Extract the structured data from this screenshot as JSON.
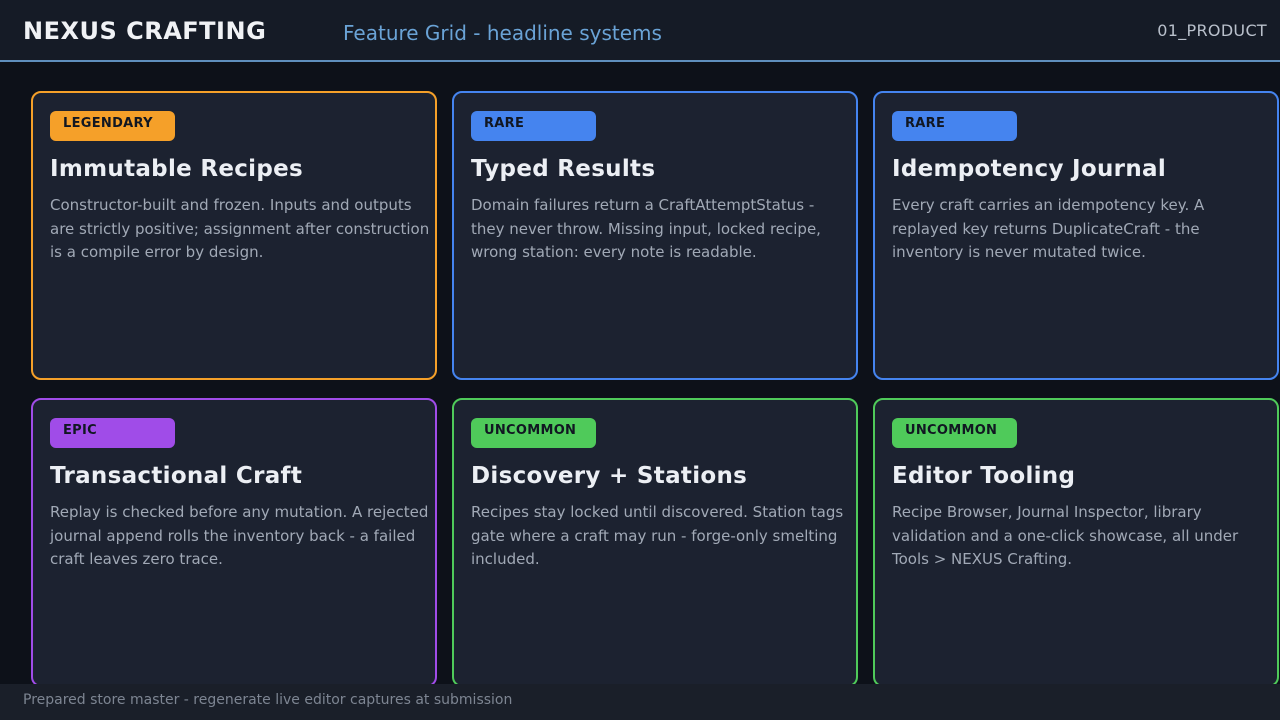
{
  "header": {
    "brand": "NEXUS CRAFTING",
    "subtitle": "Feature Grid - headline systems",
    "page_id": "01_PRODUCT"
  },
  "rarity_colors": {
    "legendary": "#f5a029",
    "rare": "#4584ef",
    "epic": "#a04ce8",
    "uncommon": "#4fca5a"
  },
  "cards": [
    {
      "rarity": "legendary",
      "badge": "LEGENDARY",
      "title": "Immutable Recipes",
      "description": "Constructor-built and frozen. Inputs and outputs are strictly positive; assignment after construction is a compile error by design."
    },
    {
      "rarity": "rare",
      "badge": "RARE",
      "title": "Typed Results",
      "description": "Domain failures return a CraftAttemptStatus - they never throw. Missing input, locked recipe, wrong station: every note is readable."
    },
    {
      "rarity": "rare",
      "badge": "RARE",
      "title": "Idempotency Journal",
      "description": "Every craft carries an idempotency key. A replayed key returns DuplicateCraft - the inventory is never mutated twice."
    },
    {
      "rarity": "epic",
      "badge": "EPIC",
      "title": "Transactional Craft",
      "description": "Replay is checked before any mutation. A rejected journal append rolls the inventory back - a failed craft leaves zero trace."
    },
    {
      "rarity": "uncommon",
      "badge": "UNCOMMON",
      "title": "Discovery + Stations",
      "description": "Recipes stay locked until discovered. Station tags gate where a craft may run - forge-only smelting included."
    },
    {
      "rarity": "uncommon",
      "badge": "UNCOMMON",
      "title": "Editor Tooling",
      "description": "Recipe Browser, Journal Inspector, library validation and a one-click showcase, all under Tools > NEXUS Crafting."
    }
  ],
  "footer": {
    "text": "Prepared store master - regenerate live editor captures at submission"
  }
}
